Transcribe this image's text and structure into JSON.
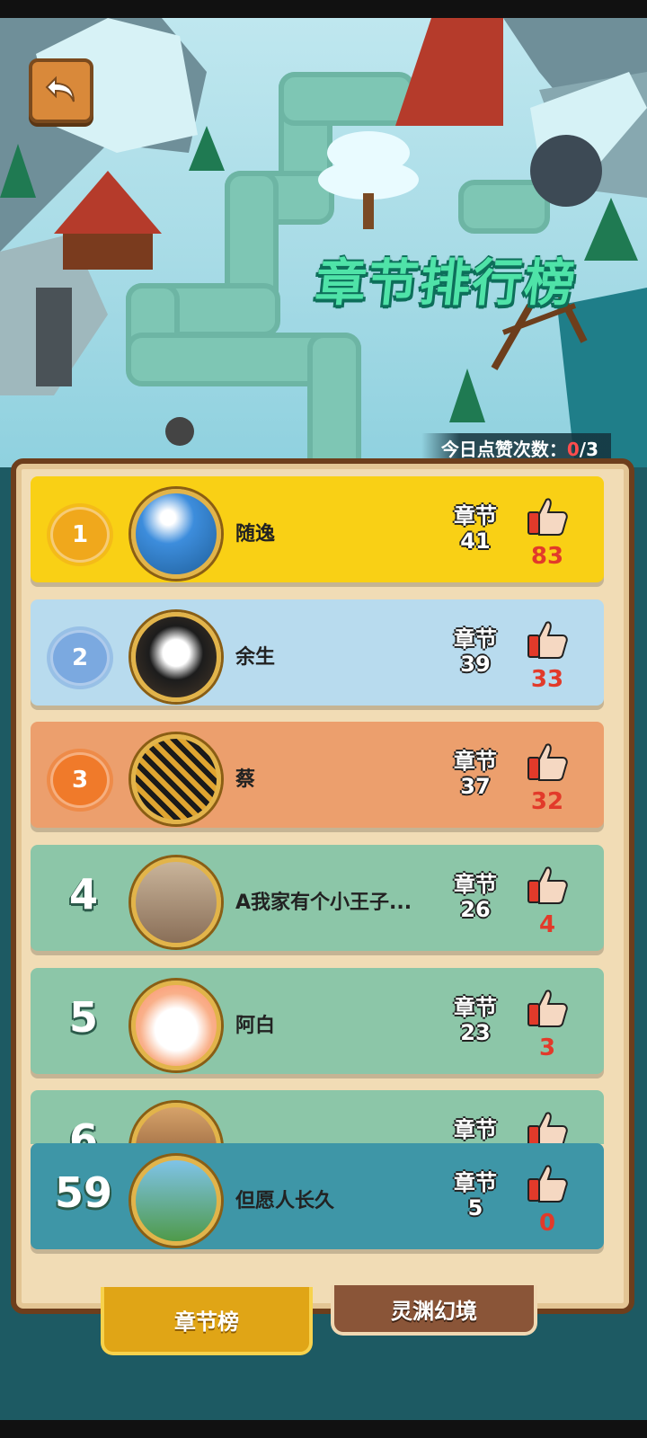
{
  "title": "章节排行榜",
  "likes_today": {
    "label": "今日点赞次数：",
    "used": "0",
    "total": "/3"
  },
  "chapter_label": "章节",
  "rows": [
    {
      "rank": "1",
      "name": "随逸",
      "chapter": "41",
      "likes": "83",
      "color": "#f9d015"
    },
    {
      "rank": "2",
      "name": "余生",
      "chapter": "39",
      "likes": "33",
      "color": "#b8dbee"
    },
    {
      "rank": "3",
      "name": "蔡",
      "chapter": "37",
      "likes": "32",
      "color": "#ec9f6d"
    },
    {
      "rank": "4",
      "name": "A我家有个小王子...",
      "chapter": "26",
      "likes": "4",
      "color": "#8cc6a8"
    },
    {
      "rank": "5",
      "name": "阿白",
      "chapter": "23",
      "likes": "3",
      "color": "#8cc6a8"
    },
    {
      "rank": "6",
      "name": "",
      "chapter": "",
      "likes": "",
      "color": "#8cc6a8"
    }
  ],
  "my_row": {
    "rank": "59",
    "name": "但愿人长久",
    "chapter": "5",
    "likes": "0",
    "color": "#3e96a7"
  },
  "tabs": {
    "chapter": "章节榜",
    "realm": "灵渊幻境"
  },
  "icons": {
    "back": "back-arrow-icon",
    "thumb": "thumbs-up-icon"
  }
}
